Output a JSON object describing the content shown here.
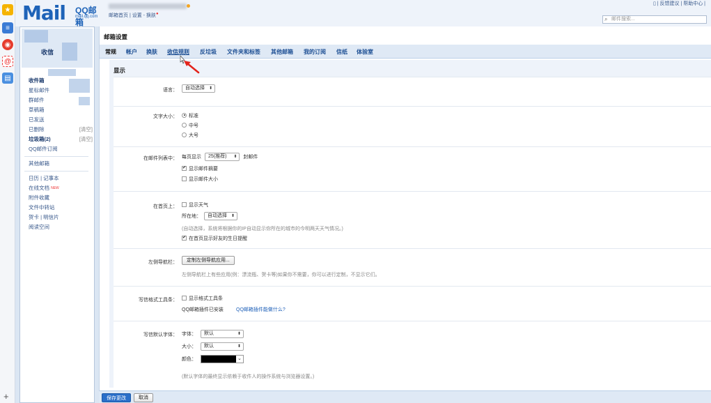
{
  "header": {
    "logo_mark": "Mail",
    "logo_brand": "QQ邮箱",
    "logo_domain": "mail.qq.com",
    "account_links": "邮箱首页 | 设置 - 换肤",
    "top_right": "| 反馈建议 | 帮助中心 |",
    "search_placeholder": "邮件搜索..."
  },
  "colors": {
    "accent": "#1e63b8",
    "primary_button": "#2a6fc9",
    "tab_bar": "#dfe9f5"
  },
  "sidebar": {
    "write": "收信",
    "folders": [
      {
        "label": "收件箱"
      },
      {
        "label": "星标邮件"
      },
      {
        "label": "群邮件"
      },
      {
        "label": "草稿箱"
      },
      {
        "label": "已发送"
      },
      {
        "label": "已删除",
        "action": "[清空]"
      },
      {
        "label": "垃圾箱(2)",
        "action": "[清空]"
      },
      {
        "label": "QQ邮件订阅"
      }
    ],
    "other_mail": "其他邮箱",
    "tools": [
      {
        "label": "日历  |  记事本"
      },
      {
        "label": "在线文档",
        "badge": "NEW"
      },
      {
        "label": "附件收藏"
      },
      {
        "label": "文件中转站"
      },
      {
        "label": "贺卡  |  明信片"
      },
      {
        "label": "阅读空间"
      }
    ]
  },
  "main": {
    "title": "邮箱设置",
    "tabs": [
      "常规",
      "帐户",
      "换肤",
      "收信规则",
      "反垃圾",
      "文件夹和标签",
      "其他邮箱",
      "我的订阅",
      "信纸",
      "体验室"
    ],
    "section": "显示",
    "language": {
      "label": "语言：",
      "value": "自动选择"
    },
    "font_size": {
      "label": "文字大小：",
      "options": [
        "标准",
        "中号",
        "大号"
      ]
    },
    "list": {
      "label": "在邮件列表中：",
      "per_page_prefix": "每页显示",
      "per_page_value": "25(推荐)",
      "per_page_suffix": "封邮件",
      "show_summary": "显示邮件摘要",
      "show_size": "显示邮件大小"
    },
    "home": {
      "label": "在首页上：",
      "show_weather": "显示天气",
      "location_label": "所在地：",
      "location_value": "自动选择",
      "note": "(自动选择，系统将根据你的IP自动显示你所在的城市的今明两天天气情况。)",
      "birthday": "在首页显示好友的生日提醒"
    },
    "leftnav": {
      "label": "左侧导航栏：",
      "button": "定制左侧导航应用...",
      "note": "左侧导航栏上有些应用(例：漂流瓶、贺卡等)如果你不需要，你可以进行定制，不显示它们。"
    },
    "toolbar": {
      "label": "写信格式工具条：",
      "option": "显示格式工具条",
      "installed": "QQ邮箱插件已安装",
      "link": "QQ邮箱插件能做什么?"
    },
    "default_font": {
      "label": "写信默认字体：",
      "font_label": "字体：",
      "font_value": "默认",
      "size_label": "大小：",
      "size_value": "默认",
      "color_label": "颜色：",
      "note": "(默认字体的最终显示依赖于收件人的操作系统与浏览器设置。)"
    }
  },
  "footer": {
    "save": "保存更改",
    "cancel": "取消"
  }
}
